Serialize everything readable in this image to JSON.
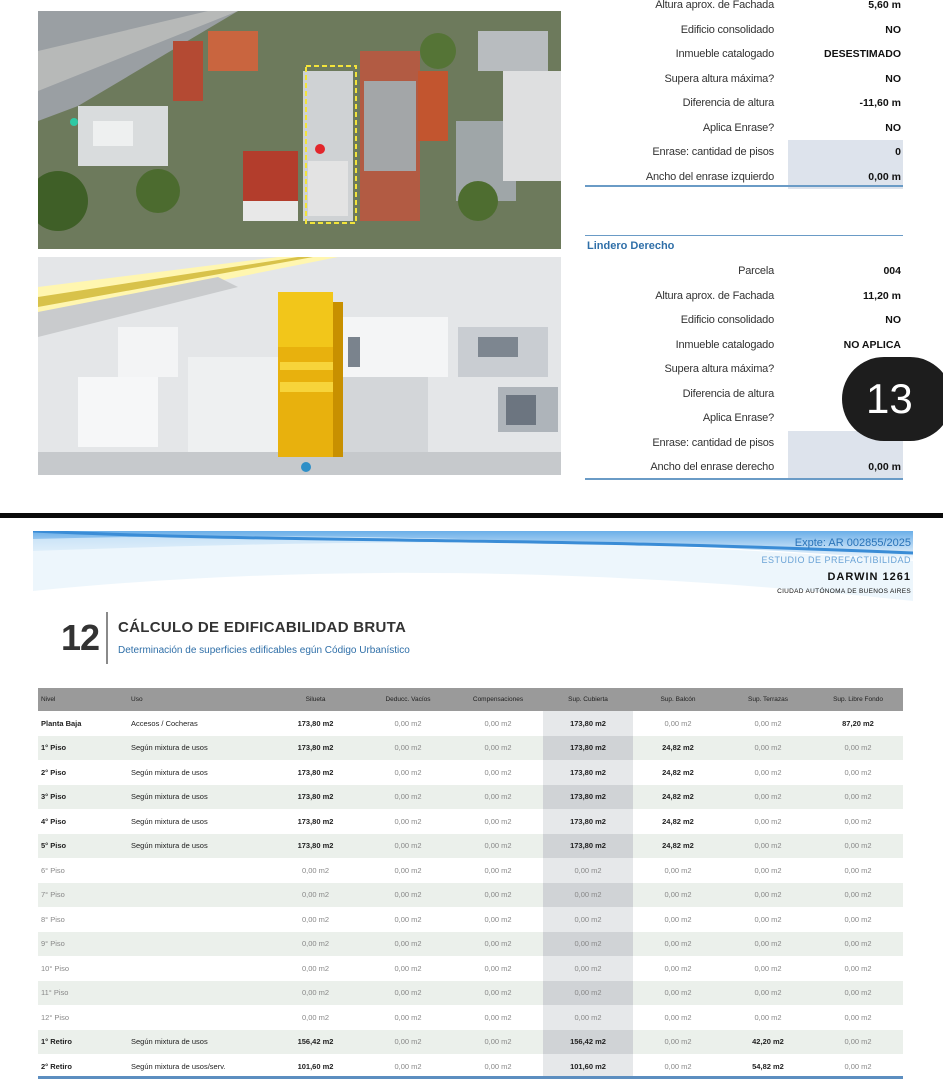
{
  "lindero_izquierdo": {
    "rows": [
      {
        "label": "Altura aprox. de Fachada",
        "value": "5,60 m",
        "shaded": false
      },
      {
        "label": "Edificio consolidado",
        "value": "NO",
        "shaded": false
      },
      {
        "label": "Inmueble catalogado",
        "value": "DESESTIMADO",
        "shaded": false
      },
      {
        "label": "Supera altura máxima?",
        "value": "NO",
        "shaded": false
      },
      {
        "label": "Diferencia de altura",
        "value": "-11,60 m",
        "shaded": false
      },
      {
        "label": "Aplica Enrase?",
        "value": "NO",
        "shaded": false
      },
      {
        "label": "Enrase: cantidad de pisos",
        "value": "0",
        "shaded": true
      },
      {
        "label": "Ancho del enrase izquierdo",
        "value": "0,00 m",
        "shaded": true
      }
    ]
  },
  "lindero_derecho": {
    "title": "Lindero Derecho",
    "rows": [
      {
        "label": "Parcela",
        "value": "004",
        "shaded": false
      },
      {
        "label": "Altura aprox. de Fachada",
        "value": "11,20 m",
        "shaded": false
      },
      {
        "label": "Edificio consolidado",
        "value": "NO",
        "shaded": false
      },
      {
        "label": "Inmueble catalogado",
        "value": "NO APLICA",
        "shaded": false
      },
      {
        "label": "Supera altura máxima?",
        "value": "",
        "shaded": false
      },
      {
        "label": "Diferencia de altura",
        "value": "",
        "shaded": false
      },
      {
        "label": "Aplica Enrase?",
        "value": "",
        "shaded": false
      },
      {
        "label": "Enrase: cantidad de pisos",
        "value": "",
        "shaded": true
      },
      {
        "label": "Ancho del enrase derecho",
        "value": "0,00 m",
        "shaded": true
      }
    ]
  },
  "page_badge": "13",
  "header": {
    "expte": "Expte: AR 002855/2025",
    "estudio": "ESTUDIO DE PREFACTIBILIDAD",
    "address": "DARWIN  1261",
    "city": "CIUDAD AUTÓNOMA DE BUENOS AIRES"
  },
  "section": {
    "number": "12",
    "title": "CÁLCULO DE EDIFICABILIDAD BRUTA",
    "subtitle": "Determinación de superficies edificables egún Código Urbanístico"
  },
  "table": {
    "columns": [
      "Nivel",
      "Uso",
      "Silueta",
      "Deducc. Vacíos",
      "Compensaciones",
      "Sup. Cubierta",
      "Sup. Balcón",
      "Sup. Terrazas",
      "Sup. Libre Fondo"
    ],
    "rows": [
      {
        "nivel": "Planta Baja",
        "uso": "Accesos / Cocheras",
        "cells": [
          "173,80 m2",
          "0,00 m2",
          "0,00 m2",
          "173,80 m2",
          "0,00 m2",
          "0,00 m2",
          "87,20 m2"
        ]
      },
      {
        "nivel": "1° Piso",
        "uso": "Según mixtura de usos",
        "cells": [
          "173,80 m2",
          "0,00 m2",
          "0,00 m2",
          "173,80 m2",
          "24,82 m2",
          "0,00 m2",
          "0,00 m2"
        ]
      },
      {
        "nivel": "2° Piso",
        "uso": "Según mixtura de usos",
        "cells": [
          "173,80 m2",
          "0,00 m2",
          "0,00 m2",
          "173,80 m2",
          "24,82 m2",
          "0,00 m2",
          "0,00 m2"
        ]
      },
      {
        "nivel": "3° Piso",
        "uso": "Según mixtura de usos",
        "cells": [
          "173,80 m2",
          "0,00 m2",
          "0,00 m2",
          "173,80 m2",
          "24,82 m2",
          "0,00 m2",
          "0,00 m2"
        ]
      },
      {
        "nivel": "4° Piso",
        "uso": "Según mixtura de usos",
        "cells": [
          "173,80 m2",
          "0,00 m2",
          "0,00 m2",
          "173,80 m2",
          "24,82 m2",
          "0,00 m2",
          "0,00 m2"
        ]
      },
      {
        "nivel": "5° Piso",
        "uso": "Según mixtura de usos",
        "cells": [
          "173,80 m2",
          "0,00 m2",
          "0,00 m2",
          "173,80 m2",
          "24,82 m2",
          "0,00 m2",
          "0,00 m2"
        ]
      },
      {
        "nivel": "6° Piso",
        "uso": "",
        "cells": [
          "0,00 m2",
          "0,00 m2",
          "0,00 m2",
          "0,00 m2",
          "0,00 m2",
          "0,00 m2",
          "0,00 m2"
        ]
      },
      {
        "nivel": "7° Piso",
        "uso": "",
        "cells": [
          "0,00 m2",
          "0,00 m2",
          "0,00 m2",
          "0,00 m2",
          "0,00 m2",
          "0,00 m2",
          "0,00 m2"
        ]
      },
      {
        "nivel": "8° Piso",
        "uso": "",
        "cells": [
          "0,00 m2",
          "0,00 m2",
          "0,00 m2",
          "0,00 m2",
          "0,00 m2",
          "0,00 m2",
          "0,00 m2"
        ]
      },
      {
        "nivel": "9° Piso",
        "uso": "",
        "cells": [
          "0,00 m2",
          "0,00 m2",
          "0,00 m2",
          "0,00 m2",
          "0,00 m2",
          "0,00 m2",
          "0,00 m2"
        ]
      },
      {
        "nivel": "10° Piso",
        "uso": "",
        "cells": [
          "0,00 m2",
          "0,00 m2",
          "0,00 m2",
          "0,00 m2",
          "0,00 m2",
          "0,00 m2",
          "0,00 m2"
        ]
      },
      {
        "nivel": "11° Piso",
        "uso": "",
        "cells": [
          "0,00 m2",
          "0,00 m2",
          "0,00 m2",
          "0,00 m2",
          "0,00 m2",
          "0,00 m2",
          "0,00 m2"
        ]
      },
      {
        "nivel": "12° Piso",
        "uso": "",
        "cells": [
          "0,00 m2",
          "0,00 m2",
          "0,00 m2",
          "0,00 m2",
          "0,00 m2",
          "0,00 m2",
          "0,00 m2"
        ]
      },
      {
        "nivel": "1° Retiro",
        "uso": "Según mixtura de usos",
        "cells": [
          "156,42 m2",
          "0,00 m2",
          "0,00 m2",
          "156,42 m2",
          "0,00 m2",
          "42,20 m2",
          "0,00 m2"
        ]
      },
      {
        "nivel": "2° Retiro",
        "uso": "Según mixtura de usos/serv.",
        "cells": [
          "101,60 m2",
          "0,00 m2",
          "0,00 m2",
          "101,60 m2",
          "0,00 m2",
          "54,82 m2",
          "0,00 m2"
        ]
      }
    ]
  }
}
